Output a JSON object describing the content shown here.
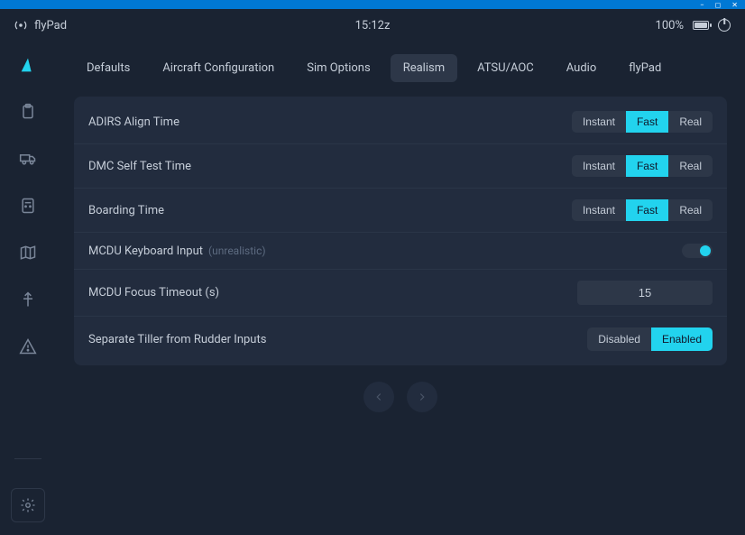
{
  "window": {
    "min": "−",
    "max": "◻",
    "close": "✕"
  },
  "header": {
    "app_name": "flyPad",
    "time": "15:12z",
    "battery": "100%"
  },
  "tabs": [
    {
      "label": "Defaults",
      "active": false
    },
    {
      "label": "Aircraft Configuration",
      "active": false
    },
    {
      "label": "Sim Options",
      "active": false
    },
    {
      "label": "Realism",
      "active": true
    },
    {
      "label": "ATSU/AOC",
      "active": false
    },
    {
      "label": "Audio",
      "active": false
    },
    {
      "label": "flyPad",
      "active": false
    }
  ],
  "settings": {
    "adirs": {
      "label": "ADIRS Align Time",
      "options": [
        "Instant",
        "Fast",
        "Real"
      ],
      "selected": "Fast"
    },
    "dmc": {
      "label": "DMC Self Test Time",
      "options": [
        "Instant",
        "Fast",
        "Real"
      ],
      "selected": "Fast"
    },
    "boarding": {
      "label": "Boarding Time",
      "options": [
        "Instant",
        "Fast",
        "Real"
      ],
      "selected": "Fast"
    },
    "mcdu_keyboard": {
      "label": "MCDU Keyboard Input",
      "hint": "(unrealistic)",
      "enabled": true
    },
    "mcdu_timeout": {
      "label": "MCDU Focus Timeout (s)",
      "value": "15"
    },
    "tiller": {
      "label": "Separate Tiller from Rudder Inputs",
      "options": [
        "Disabled",
        "Enabled"
      ],
      "selected": "Enabled"
    }
  }
}
